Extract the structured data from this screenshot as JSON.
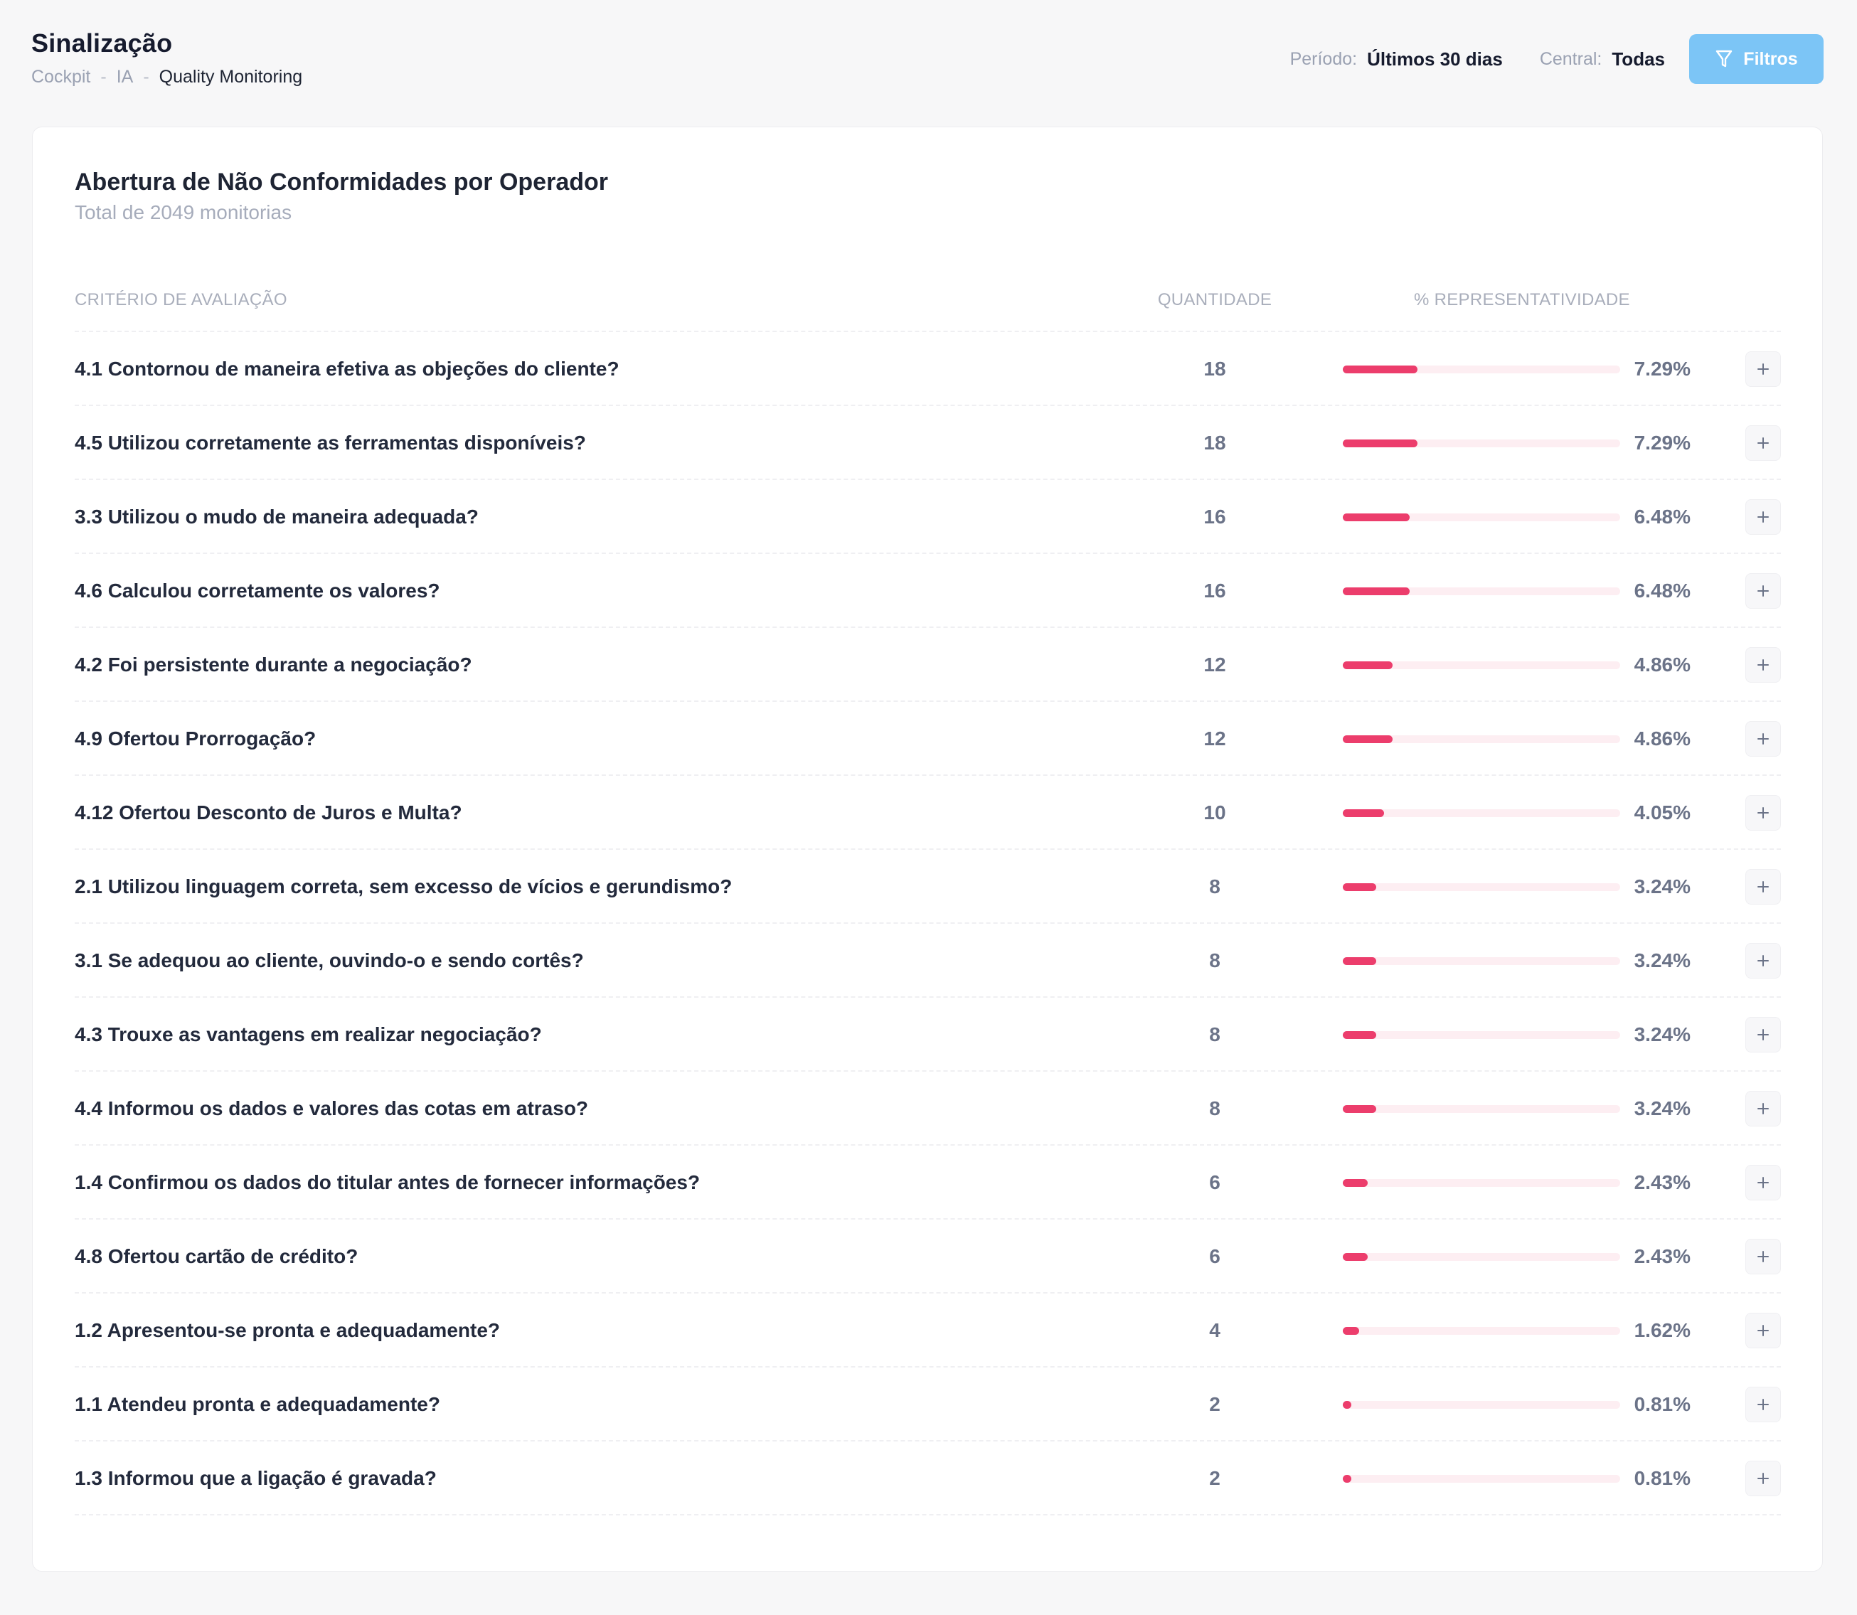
{
  "header": {
    "title": "Sinalização",
    "breadcrumb": [
      "Cockpit",
      "IA",
      "Quality Monitoring"
    ],
    "periodo_label": "Período:",
    "periodo_value": "Últimos 30 dias",
    "central_label": "Central:",
    "central_value": "Todas",
    "filters_label": "Filtros"
  },
  "card": {
    "title": "Abertura de Não Conformidades por Operador",
    "subtitle": "Total de 2049 monitorias"
  },
  "table": {
    "columns": {
      "criterio": "CRITÉRIO DE AVALIAÇÃO",
      "quantidade": "QUANTIDADE",
      "representatividade": "% REPRESENTATIVIDADE"
    },
    "rows": [
      {
        "criterio": "4.1 Contornou de maneira efetiva as objeções do cliente?",
        "quantidade": "18",
        "percent": "7.29%",
        "fraction": 0.0729
      },
      {
        "criterio": "4.5 Utilizou corretamente as ferramentas disponíveis?",
        "quantidade": "18",
        "percent": "7.29%",
        "fraction": 0.0729
      },
      {
        "criterio": "3.3 Utilizou o mudo de maneira adequada?",
        "quantidade": "16",
        "percent": "6.48%",
        "fraction": 0.0648
      },
      {
        "criterio": "4.6 Calculou corretamente os valores?",
        "quantidade": "16",
        "percent": "6.48%",
        "fraction": 0.0648
      },
      {
        "criterio": "4.2 Foi persistente durante a negociação?",
        "quantidade": "12",
        "percent": "4.86%",
        "fraction": 0.0486
      },
      {
        "criterio": "4.9 Ofertou Prorrogação?",
        "quantidade": "12",
        "percent": "4.86%",
        "fraction": 0.0486
      },
      {
        "criterio": "4.12 Ofertou Desconto de Juros e Multa?",
        "quantidade": "10",
        "percent": "4.05%",
        "fraction": 0.0405
      },
      {
        "criterio": "2.1 Utilizou linguagem correta, sem excesso de vícios e gerundismo?",
        "quantidade": "8",
        "percent": "3.24%",
        "fraction": 0.0324
      },
      {
        "criterio": "3.1 Se adequou ao cliente, ouvindo-o e sendo cortês?",
        "quantidade": "8",
        "percent": "3.24%",
        "fraction": 0.0324
      },
      {
        "criterio": "4.3 Trouxe as vantagens em realizar negociação?",
        "quantidade": "8",
        "percent": "3.24%",
        "fraction": 0.0324
      },
      {
        "criterio": "4.4 Informou os dados e valores das cotas em atraso?",
        "quantidade": "8",
        "percent": "3.24%",
        "fraction": 0.0324
      },
      {
        "criterio": "1.4 Confirmou os dados do titular antes de fornecer informações?",
        "quantidade": "6",
        "percent": "2.43%",
        "fraction": 0.0243
      },
      {
        "criterio": "4.8 Ofertou cartão de crédito?",
        "quantidade": "6",
        "percent": "2.43%",
        "fraction": 0.0243
      },
      {
        "criterio": "1.2 Apresentou-se pronta e adequadamente?",
        "quantidade": "4",
        "percent": "1.62%",
        "fraction": 0.0162
      },
      {
        "criterio": "1.1 Atendeu pronta e adequadamente?",
        "quantidade": "2",
        "percent": "0.81%",
        "fraction": 0.0081
      },
      {
        "criterio": "1.3 Informou que a ligação é gravada?",
        "quantidade": "2",
        "percent": "0.81%",
        "fraction": 0.0081
      }
    ]
  },
  "icons": {
    "filters": "filter-icon",
    "expand": "plus-icon"
  },
  "colors": {
    "accent": "#7cc5f6",
    "bar_fill": "#ec3d6c",
    "bar_track": "#fdeef2"
  }
}
